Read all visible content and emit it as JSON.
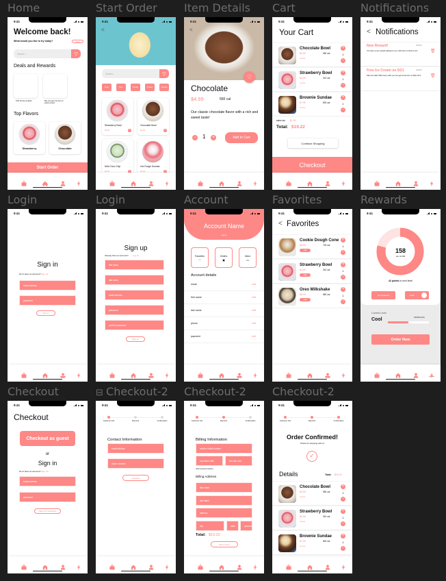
{
  "colors": {
    "accent": "#fd8886",
    "canvas_bg": "#1e1e1e",
    "label": "#6c6c6c"
  },
  "status_time": "9:41",
  "frame_labels": [
    "Home",
    "Start Order",
    "Item Details",
    "Cart",
    "Notifications",
    "Login",
    "Login",
    "Account",
    "Favorites",
    "Rewards",
    "Checkout",
    "Checkout-2",
    "Checkout-2",
    "Checkout-2"
  ],
  "nav_icons": [
    "bag-icon",
    "home-icon",
    "user-icon",
    "bolt-icon"
  ],
  "home": {
    "title": "Welcome back!",
    "subtitle": "What would you like to try today?",
    "view_label": "View",
    "search_placeholder": "Search...",
    "deals_heading": "Deals and Rewards",
    "deals": [
      "10% off any sundae!",
      "Buy one get one free on select cones!"
    ],
    "flavors_heading": "Top Flavors",
    "flavors": [
      "Strawberry",
      "Chocolate"
    ],
    "start_order": "Start Order"
  },
  "start_order": {
    "back": "<",
    "search_placeholder": "Search...",
    "chips": [
      "Bowl",
      "Cone",
      "Sundae",
      "Shakes",
      "Specials"
    ],
    "products": [
      {
        "name": "Strawberry Bowl",
        "price": "$4.99"
      },
      {
        "name": "Chocolate Bowl",
        "price": "$4.99"
      },
      {
        "name": "Mint Choc Chip",
        "price": "$4.99"
      },
      {
        "name": "Hot Fudge Sundae",
        "price": "$7.99"
      }
    ]
  },
  "item": {
    "back": "<",
    "name": "Chocolate",
    "price": "$4.99",
    "calories": "550 cal",
    "description": "Our classic chocolate flavor with a rich and sweet taste!",
    "quantity": "1",
    "add_to_cart": "Add to Cart"
  },
  "cart": {
    "title": "Your Cart",
    "items": [
      {
        "name": "Chocolate Bowl",
        "price": "$4.99",
        "cal": "550 cal",
        "action": "remove",
        "qty": "1",
        "image": "choc"
      },
      {
        "name": "Strawberry Bowl",
        "price": "$4.99",
        "cal": "310 cal",
        "action": "remove",
        "qty": "1",
        "image": "straw"
      },
      {
        "name": "Brownie Sundae",
        "price": "$7.99",
        "cal": "800 cal",
        "action": "remove",
        "qty": "1",
        "image": "brownie"
      }
    ],
    "tax_label": "sales tax",
    "tax": "$1.25",
    "total_label": "Total:",
    "total": "$19.22",
    "continue": "Continue Shopping",
    "checkout": "Checkout"
  },
  "notifications": {
    "back": "<",
    "title": "Notifications",
    "items": [
      {
        "title": "New Reward!",
        "date": "2/26/24",
        "body": "You have a new reward waiting for you, click here to check it out!"
      },
      {
        "title": "Free Ice Cream on 5/21",
        "date": "2/26/24",
        "body": "Save the date! With every order you can get a free item on May 21st!"
      }
    ]
  },
  "signin": {
    "title": "Sign in",
    "prompt": "Don't have an account?",
    "link": "Sign up!",
    "email": "email address",
    "password": "password",
    "button": "Sign in"
  },
  "signup": {
    "title": "Sign up",
    "prompt": "Already have an account?",
    "link": "Log in!",
    "fields": [
      "first name",
      "last name",
      "email address",
      "password",
      "confirm password"
    ],
    "button": "Sign up"
  },
  "account": {
    "name": "Account Name",
    "logout": "logout",
    "tiles": [
      "Favorites",
      "Orders",
      "Inbox"
    ],
    "details_heading": "Account details",
    "rows": [
      "email",
      "first name",
      "last name",
      "phone",
      "payment"
    ],
    "edit": "edit"
  },
  "favorites": {
    "back": "<",
    "title": "Favorites",
    "items": [
      {
        "name": "Cookie Dough Cone",
        "price": "$5.99",
        "cal": "700 cal",
        "action": "Add",
        "qty": "1",
        "image": "cookie"
      },
      {
        "name": "Strawberry Bowl",
        "price": "$4.99",
        "cal": "310 cal",
        "action": "Add",
        "qty": "1",
        "image": "straw"
      },
      {
        "name": "Oreo Milkshake",
        "price": "$5.49",
        "cal": "850 cal",
        "action": "Add",
        "qty": "1",
        "image": "oreo"
      }
    ]
  },
  "rewards": {
    "points": "158",
    "out_of": "out of 200",
    "points_fraction": 0.79,
    "next_level_points": "42 points",
    "next_level_text": "to next level",
    "my_rewards": "My Rewards",
    "scan": "Scan",
    "current_level_label": "Current Level",
    "level": "Cool",
    "level_progress_text": "100/200 points",
    "level_progress": 0.5,
    "order_now": "Order Now"
  },
  "checkout": {
    "title": "Checkout",
    "guest": "Checkout as guest",
    "or": "or",
    "signin_title": "Sign in",
    "prompt": "Don't have an account?",
    "link": "Sign up!",
    "email": "email address",
    "password": "password",
    "button": "Sign in & Checkout"
  },
  "steps": [
    "Customer Info",
    "Payment",
    "Confirmation"
  ],
  "contact": {
    "heading": "Contact Information",
    "email": "email address",
    "phone": "phone number",
    "continue": "Continue"
  },
  "billing": {
    "heading": "Billing Information",
    "card": "credit or debit number",
    "exp": "expiration date",
    "sec": "security num",
    "other": "other payment options",
    "address_heading": "Billing Address",
    "first": "first name",
    "last": "last name",
    "address": "address",
    "city": "city",
    "state": "state",
    "zip": "zipcode",
    "total_label": "Total:",
    "total": "$19.22",
    "place_order": "Place Order"
  },
  "confirmed": {
    "title": "Order Confirmed!",
    "thanks": "Thanks for shopping with us!",
    "details": "Details",
    "total_label": "Total:",
    "total": "$19.22",
    "items": [
      {
        "name": "Chocolate Bowl",
        "price": "$4.99",
        "cal": "550 cal",
        "action": "remove",
        "qty": "1",
        "image": "choc"
      },
      {
        "name": "Strawberry Bowl",
        "price": "$4.99",
        "cal": "310 cal",
        "action": "remove",
        "qty": "1",
        "image": "straw"
      },
      {
        "name": "Brownie Sundae",
        "price": "$7.99",
        "cal": "800 cal",
        "action": "remove",
        "qty": "1",
        "image": "brownie"
      }
    ]
  }
}
